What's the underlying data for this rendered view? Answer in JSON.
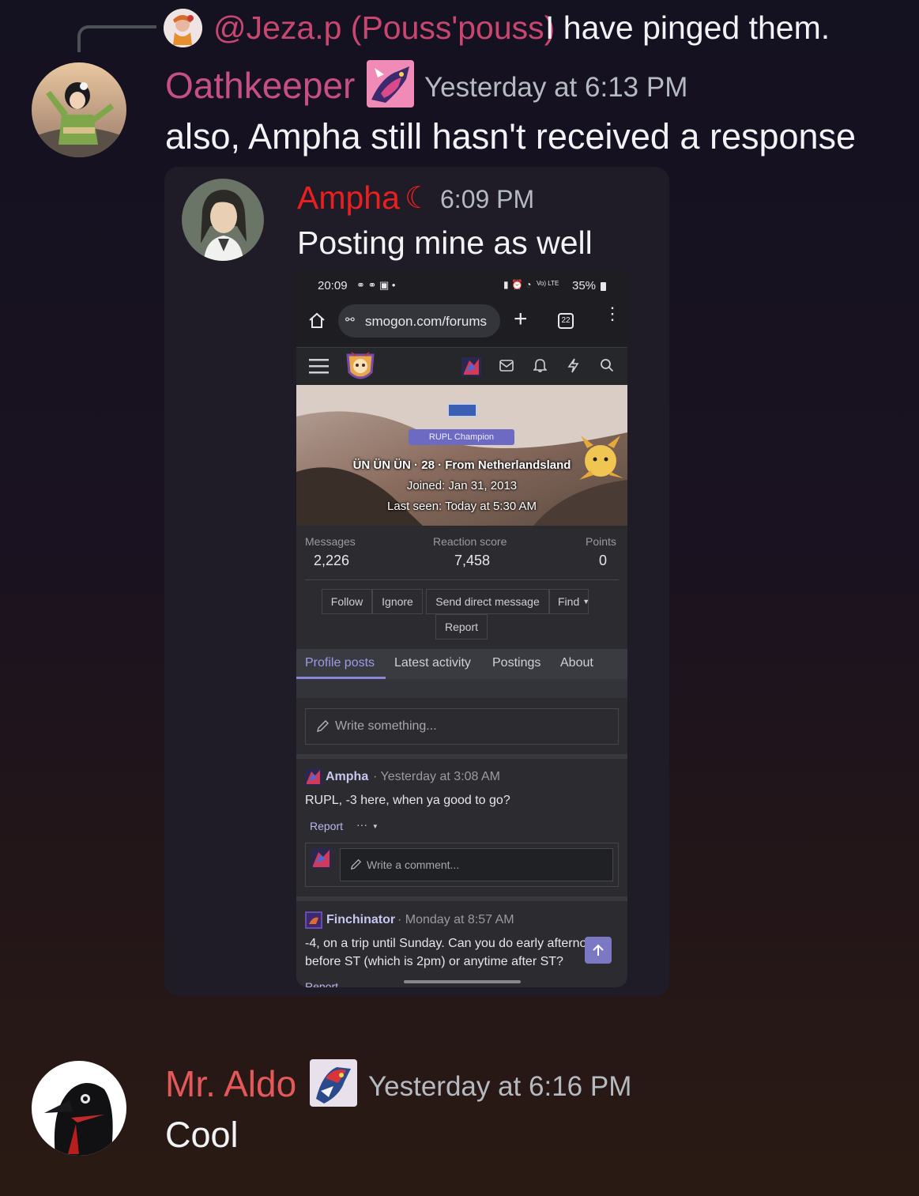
{
  "reply": {
    "mention": "@Jeza.p (Pouss'pouss)",
    "text": "I have pinged them."
  },
  "messages": [
    {
      "username": "Oathkeeper",
      "username_color": "#c54f86",
      "timestamp": "Yesterday at 6:13 PM",
      "text": "also, Ampha still hasn't received a response"
    },
    {
      "username": "Mr. Aldo",
      "username_color": "#e4585a",
      "timestamp": "Yesterday at 6:16 PM",
      "text": "Cool"
    }
  ],
  "embed": {
    "username": "Ampha",
    "username_color": "#ea1f1f",
    "badge_glyph": "☾",
    "timestamp": "6:09 PM",
    "text": "Posting mine as well"
  },
  "screenshot": {
    "status": {
      "time": "20:09",
      "battery": "35%",
      "network": "Vo) LTE"
    },
    "browser": {
      "url": "smogon.com/forums",
      "tab_count": "22"
    },
    "profile": {
      "badge": "RUPL Champion",
      "info": "ÜN ÜN ÜN · 28 · From Netherlandsland",
      "joined": "Joined: Jan 31, 2013",
      "last_seen": "Last seen: Today at 5:30 AM",
      "stats": [
        {
          "label": "Messages",
          "value": "2,226"
        },
        {
          "label": "Reaction score",
          "value": "7,458"
        },
        {
          "label": "Points",
          "value": "0"
        }
      ],
      "actions": [
        "Follow",
        "Ignore",
        "Send direct message",
        "Find"
      ],
      "report": "Report"
    },
    "tabs": [
      "Profile posts",
      "Latest activity",
      "Postings",
      "About"
    ],
    "write_placeholder": "Write something...",
    "posts": [
      {
        "author": "Ampha",
        "meta": "· Yesterday at 3:08 AM",
        "body": "RUPL, -3 here, when ya good to go?",
        "report": "Report",
        "more": "···",
        "comment_placeholder": "Write a comment..."
      },
      {
        "author": "Finchinator",
        "meta": "· Monday at 8:57 AM",
        "body1": "-4, on a trip until Sunday. Can you do early afternoon",
        "body2": "before ST (which is 2pm) or anytime after ST?",
        "report": "Report"
      }
    ]
  }
}
